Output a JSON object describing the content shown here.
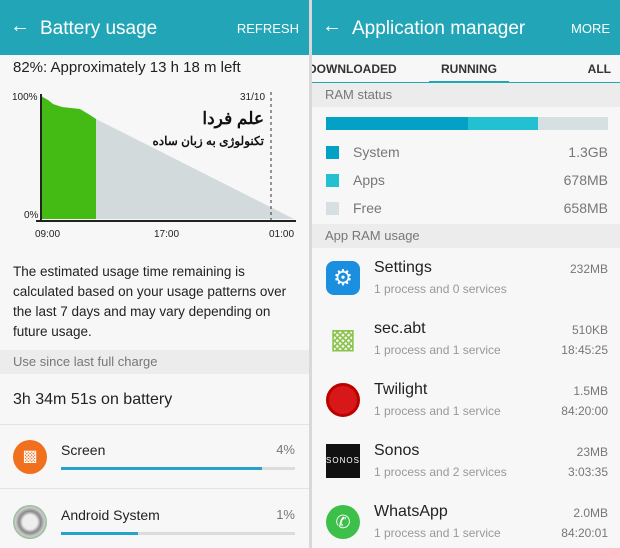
{
  "battery": {
    "title": "Battery usage",
    "refresh": "REFRESH",
    "status": "82%: Approximately 13 h 18 m left",
    "chart": {
      "y_top": "100%",
      "y_bottom": "0%",
      "date_marker": "31/10",
      "x_ticks": [
        "09:00",
        "17:00",
        "01:00"
      ],
      "watermark_title": "علم فردا",
      "watermark_subtitle": "تکنولوژی به زبان ساده"
    },
    "description": "The estimated usage time remaining is calculated based on your usage patterns over the last 7 days and may vary depending on future usage.",
    "section": "Use since last full charge",
    "on_battery": "3h 34m 51s on battery",
    "items": [
      {
        "name": "Screen",
        "percent": "4%",
        "fill": 0.86
      },
      {
        "name": "Android System",
        "percent": "1%",
        "fill": 0.33
      }
    ],
    "colors": {
      "used": "#44bb14",
      "predicted": "#d3dadb",
      "accent": "#22a5b6"
    }
  },
  "apps": {
    "title": "Application manager",
    "more": "MORE",
    "tabs": [
      "DOWNLOADED",
      "RUNNING",
      "ALL"
    ],
    "active_tab": "RUNNING",
    "ram_section": "RAM status",
    "ram": [
      {
        "label": "System",
        "value": "1.3GB",
        "color": "#03a1c5",
        "fraction": 0.503
      },
      {
        "label": "Apps",
        "value": "678MB",
        "color": "#22c0d0",
        "fraction": 0.25
      },
      {
        "label": "Free",
        "value": "658MB",
        "color": "#d6dfe1",
        "fraction": 0.247
      }
    ],
    "usage_section": "App RAM usage",
    "list": [
      {
        "name": "Settings",
        "sub": "1 process and 0 services",
        "size": "232MB",
        "time": ""
      },
      {
        "name": "sec.abt",
        "sub": "1 process and 1 service",
        "size": "510KB",
        "time": "18:45:25"
      },
      {
        "name": "Twilight",
        "sub": "1 process and 1 service",
        "size": "1.5MB",
        "time": "84:20:00"
      },
      {
        "name": "Sonos",
        "sub": "1 process and 2 services",
        "size": "23MB",
        "time": "3:03:35",
        "logo": "SONOS"
      },
      {
        "name": "WhatsApp",
        "sub": "1 process and 1 service",
        "size": "2.0MB",
        "time": "84:20:01"
      }
    ]
  }
}
